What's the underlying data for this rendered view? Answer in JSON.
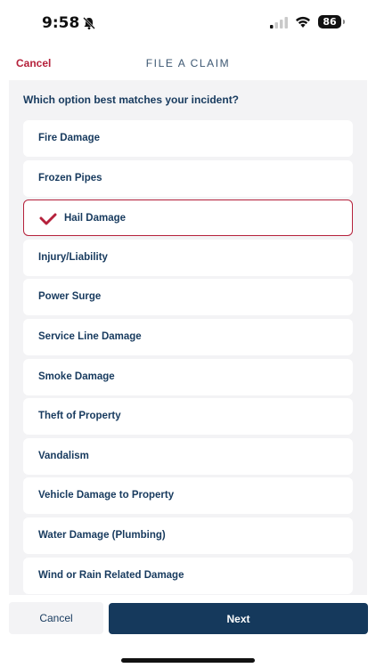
{
  "status_bar": {
    "time": "9:58",
    "battery": "86",
    "icons": [
      "bell-slash-icon",
      "cellular-signal-icon",
      "wifi-icon",
      "battery-icon"
    ]
  },
  "nav": {
    "cancel_label": "Cancel",
    "title": "FILE A CLAIM"
  },
  "question": "Which option best matches your incident?",
  "options": [
    {
      "label": "Fire Damage",
      "selected": false
    },
    {
      "label": "Frozen Pipes",
      "selected": false
    },
    {
      "label": "Hail Damage",
      "selected": true
    },
    {
      "label": "Injury/Liability",
      "selected": false
    },
    {
      "label": "Power Surge",
      "selected": false
    },
    {
      "label": "Service Line Damage",
      "selected": false
    },
    {
      "label": "Smoke Damage",
      "selected": false
    },
    {
      "label": "Theft of Property",
      "selected": false
    },
    {
      "label": "Vandalism",
      "selected": false
    },
    {
      "label": "Vehicle Damage to Property",
      "selected": false
    },
    {
      "label": "Water Damage (Plumbing)",
      "selected": false
    },
    {
      "label": "Wind or Rain Related Damage",
      "selected": false
    }
  ],
  "footer": {
    "cancel_label": "Cancel",
    "next_label": "Next"
  },
  "colors": {
    "accent_red": "#b5213b",
    "navy": "#15395c",
    "list_background": "#f3f3f5"
  }
}
